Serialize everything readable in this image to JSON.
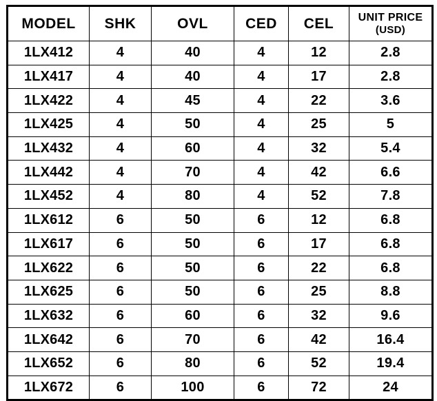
{
  "table": {
    "columns": [
      {
        "key": "model",
        "label": "MODEL"
      },
      {
        "key": "shk",
        "label": "SHK"
      },
      {
        "key": "ovl",
        "label": "OVL"
      },
      {
        "key": "ced",
        "label": "CED"
      },
      {
        "key": "cel",
        "label": "CEL"
      },
      {
        "key": "price",
        "label": "UNIT PRICE",
        "label_line2": "(USD)"
      }
    ],
    "rows": [
      {
        "model": "1LX412",
        "shk": "4",
        "ovl": "40",
        "ced": "4",
        "cel": "12",
        "price": "2.8"
      },
      {
        "model": "1LX417",
        "shk": "4",
        "ovl": "40",
        "ced": "4",
        "cel": "17",
        "price": "2.8"
      },
      {
        "model": "1LX422",
        "shk": "4",
        "ovl": "45",
        "ced": "4",
        "cel": "22",
        "price": "3.6"
      },
      {
        "model": "1LX425",
        "shk": "4",
        "ovl": "50",
        "ced": "4",
        "cel": "25",
        "price": "5"
      },
      {
        "model": "1LX432",
        "shk": "4",
        "ovl": "60",
        "ced": "4",
        "cel": "32",
        "price": "5.4"
      },
      {
        "model": "1LX442",
        "shk": "4",
        "ovl": "70",
        "ced": "4",
        "cel": "42",
        "price": "6.6"
      },
      {
        "model": "1LX452",
        "shk": "4",
        "ovl": "80",
        "ced": "4",
        "cel": "52",
        "price": "7.8"
      },
      {
        "model": "1LX612",
        "shk": "6",
        "ovl": "50",
        "ced": "6",
        "cel": "12",
        "price": "6.8"
      },
      {
        "model": "1LX617",
        "shk": "6",
        "ovl": "50",
        "ced": "6",
        "cel": "17",
        "price": "6.8"
      },
      {
        "model": "1LX622",
        "shk": "6",
        "ovl": "50",
        "ced": "6",
        "cel": "22",
        "price": "6.8"
      },
      {
        "model": "1LX625",
        "shk": "6",
        "ovl": "50",
        "ced": "6",
        "cel": "25",
        "price": "8.8"
      },
      {
        "model": "1LX632",
        "shk": "6",
        "ovl": "60",
        "ced": "6",
        "cel": "32",
        "price": "9.6"
      },
      {
        "model": "1LX642",
        "shk": "6",
        "ovl": "70",
        "ced": "6",
        "cel": "42",
        "price": "16.4"
      },
      {
        "model": "1LX652",
        "shk": "6",
        "ovl": "80",
        "ced": "6",
        "cel": "52",
        "price": "19.4"
      },
      {
        "model": "1LX672",
        "shk": "6",
        "ovl": "100",
        "ced": "6",
        "cel": "72",
        "price": "24"
      }
    ]
  },
  "colors": {
    "text": "#000000",
    "background": "#ffffff",
    "grid": "#000000"
  }
}
